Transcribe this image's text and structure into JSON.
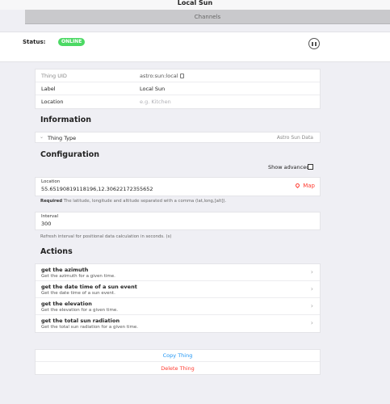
{
  "header": {
    "title": "Local Sun"
  },
  "tabs": [
    {
      "label": "Channels"
    }
  ],
  "status": {
    "label": "Status:",
    "badge": "ONLINE"
  },
  "properties": [
    {
      "label": "Thing UID",
      "value": "astro:sun:local"
    },
    {
      "label": "Label",
      "value": "Local Sun"
    },
    {
      "label": "Location",
      "placeholder": "e.g. Kitchen"
    }
  ],
  "information": {
    "title": "Information",
    "thing_type": {
      "label": "Thing Type",
      "value": "Astro Sun Data"
    }
  },
  "configuration": {
    "title": "Configuration",
    "show_advanced": "Show advanced",
    "location": {
      "label": "Location",
      "value": "55.65190819118196,12.30622172355652",
      "map_label": "Map",
      "hint_required": "Required",
      "hint": "The latitude, longitude and altitude separated with a comma (lat,long,[alt])."
    },
    "interval": {
      "label": "Interval",
      "value": "300",
      "hint": "Refresh interval for positional data calculation in seconds. (s)"
    }
  },
  "actions": {
    "title": "Actions",
    "items": [
      {
        "title": "get the azimuth",
        "desc": "Get the azimuth for a given time."
      },
      {
        "title": "get the date time of a sun event",
        "desc": "Get the date time of a sun event."
      },
      {
        "title": "get the elevation",
        "desc": "Get the elevation for a given time."
      },
      {
        "title": "get the total sun radiation",
        "desc": "Get the total sun radiation for a given time."
      }
    ]
  },
  "buttons": {
    "copy": "Copy Thing",
    "delete": "Delete Thing"
  },
  "colors": {
    "online": "#4cd964",
    "accent": "#2196f3",
    "danger": "#ff3b30"
  }
}
